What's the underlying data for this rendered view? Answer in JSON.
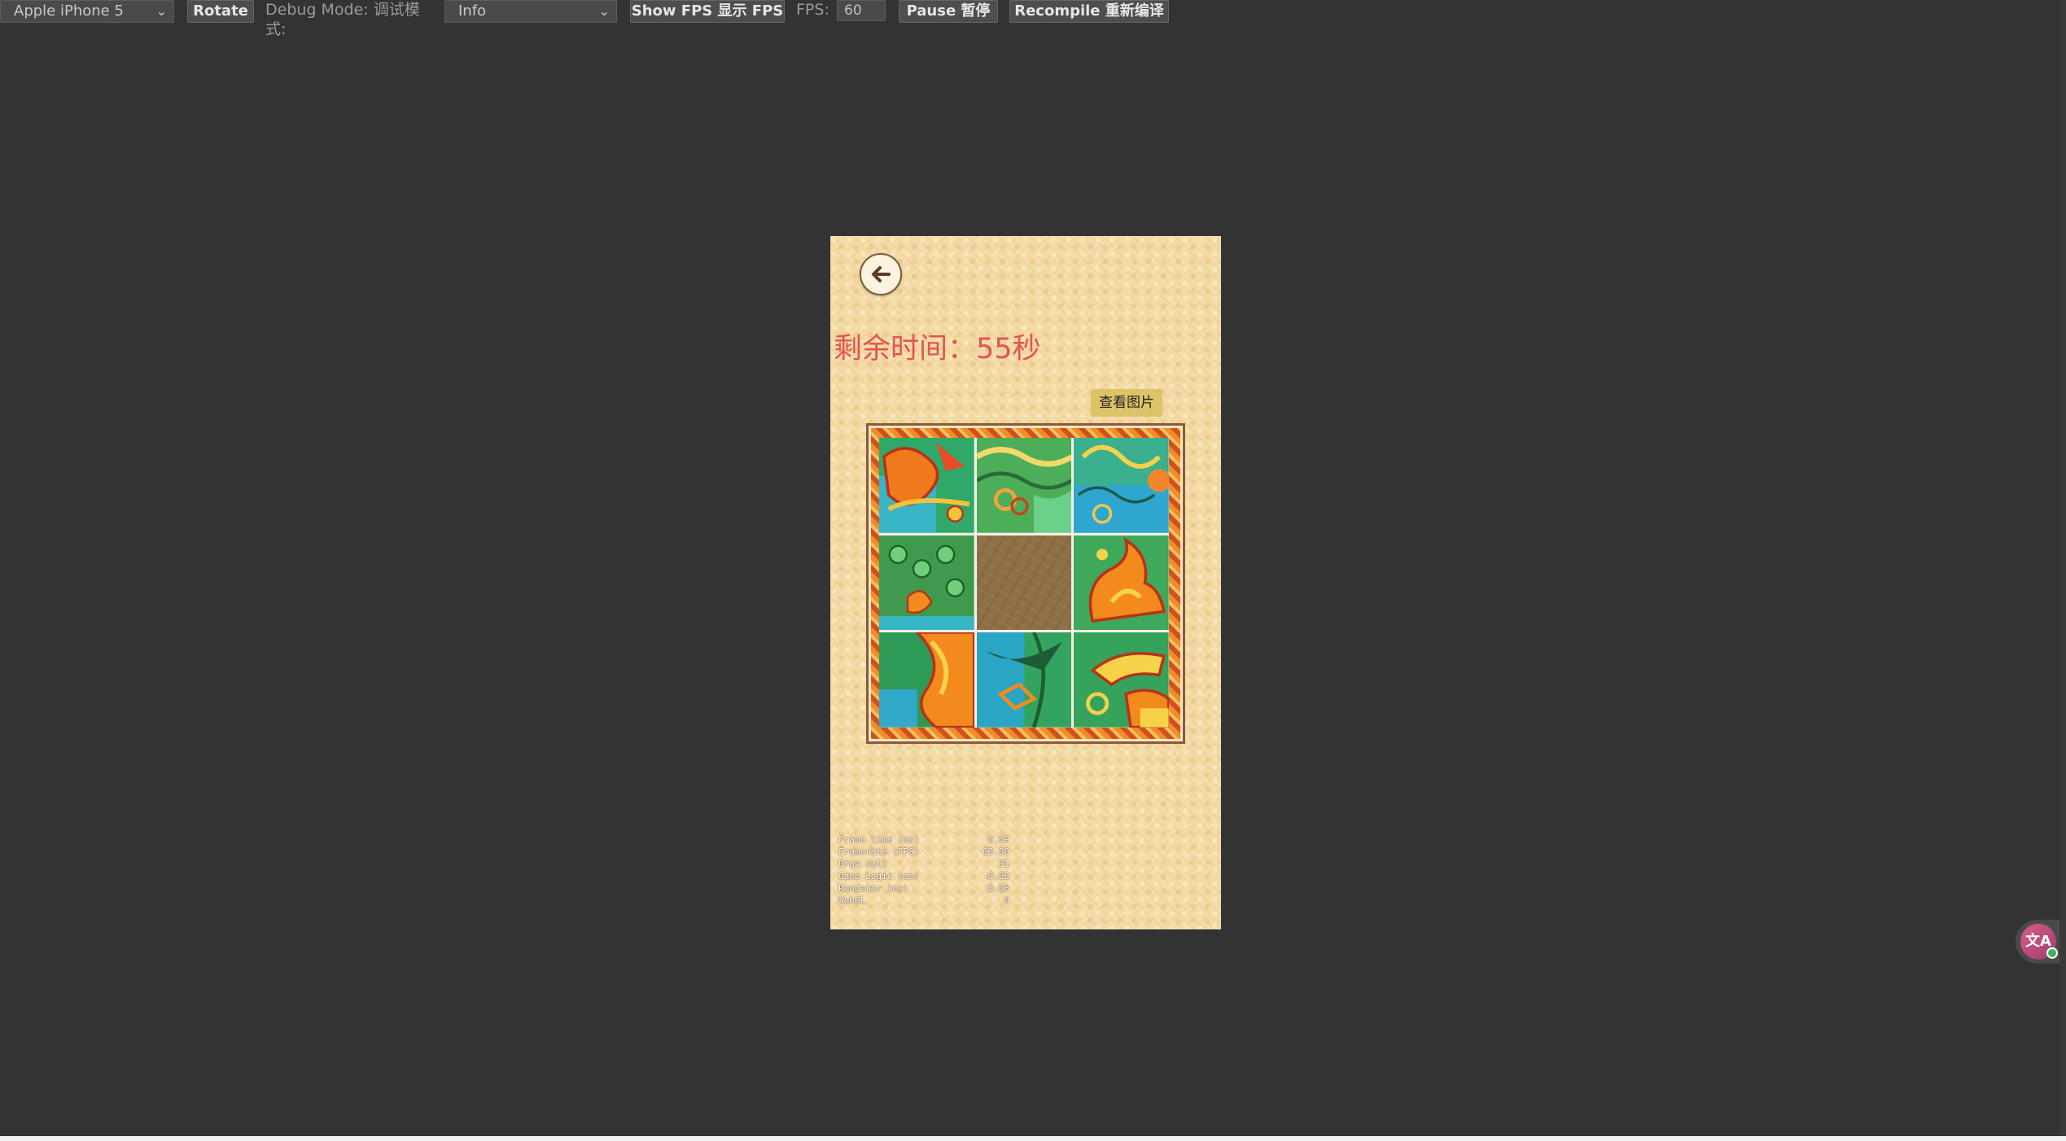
{
  "toolbar": {
    "device_select": "Apple iPhone 5",
    "rotate_label": "Rotate",
    "debug_mode_label": "Debug Mode:  调试模式:",
    "debug_mode_select": "Info",
    "show_fps_label": "Show FPS  显示 FPS",
    "fps_label": "FPS:",
    "fps_value": "60",
    "pause_label": "Pause  暂停",
    "recompile_label": "Recompile  重新编译"
  },
  "game": {
    "timer_text": "剩余时间：55秒",
    "view_image_label": "查看图片",
    "puzzle": {
      "rows": 3,
      "cols": 3,
      "empty_index": 4
    },
    "stats": [
      {
        "label": "Frame time (ms)",
        "value": "0.09"
      },
      {
        "label": "Framerate (FPS)",
        "value": "60.00"
      },
      {
        "label": "Draw call",
        "value": "31"
      },
      {
        "label": "Game Logic (ms)",
        "value": "0.02"
      },
      {
        "label": "Renderer (ms)",
        "value": "0.08"
      },
      {
        "label": "WebGL",
        "value": "0"
      }
    ]
  },
  "colors": {
    "background": "#333333",
    "timer": "#e05550",
    "view_button": "#dcc367"
  },
  "icons": {
    "back": "arrow-left-icon",
    "translate": "translate-icon"
  }
}
